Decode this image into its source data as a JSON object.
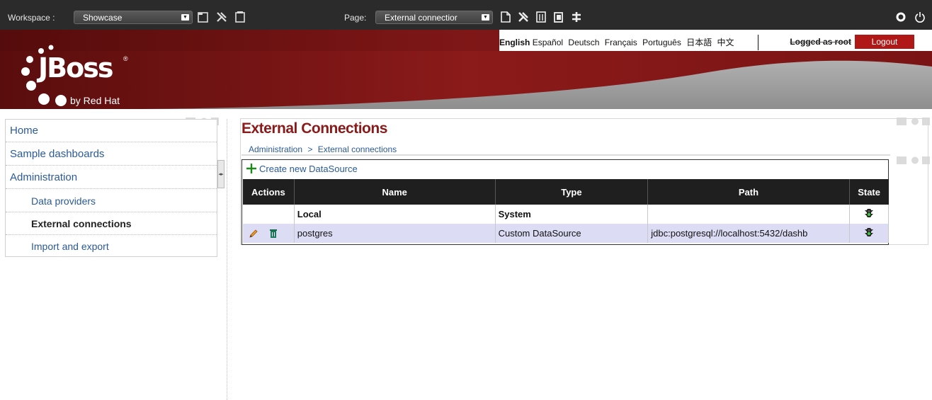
{
  "topbar": {
    "workspace_label": "Workspace :",
    "workspace_value": "Showcase",
    "page_label": "Page:",
    "page_value": "External connectior"
  },
  "langbar": {
    "languages": [
      "English",
      "Español",
      "Deutsch",
      "Français",
      "Português",
      "日本語",
      "中文"
    ],
    "active_language": "English",
    "logged_as": "Logged as root",
    "logout_label": "Logout"
  },
  "header": {
    "logo_text": "JBoss",
    "logo_sub": "by Red Hat",
    "logo_mark": "®",
    "colors": {
      "brand_red": "#8b1a1a",
      "banner_dark": "#5a0d0d",
      "gray": "#9a9a9a"
    }
  },
  "nav": {
    "items": [
      {
        "label": "Home"
      },
      {
        "label": "Sample dashboards"
      },
      {
        "label": "Administration"
      }
    ],
    "subitems": [
      {
        "label": "Data providers"
      },
      {
        "label": "External connections",
        "active": true
      },
      {
        "label": "Import and export"
      }
    ]
  },
  "main": {
    "title": "External Connections",
    "breadcrumb": [
      "Administration",
      "External connections"
    ],
    "breadcrumb_sep": ">",
    "create_label": "Create new DataSource",
    "table": {
      "headers": [
        "Actions",
        "Name",
        "Type",
        "Path",
        "State"
      ],
      "rows": [
        {
          "name": "Local",
          "type": "System",
          "path": "",
          "state_icon": "traffic-light-green-icon",
          "actions": []
        },
        {
          "name": "postgres",
          "type": "Custom DataSource",
          "path": "jdbc:postgresql://localhost:5432/dashb",
          "state_icon": "traffic-light-green-icon",
          "actions": [
            "edit-pencil-icon",
            "delete-trash-icon"
          ]
        }
      ]
    }
  }
}
